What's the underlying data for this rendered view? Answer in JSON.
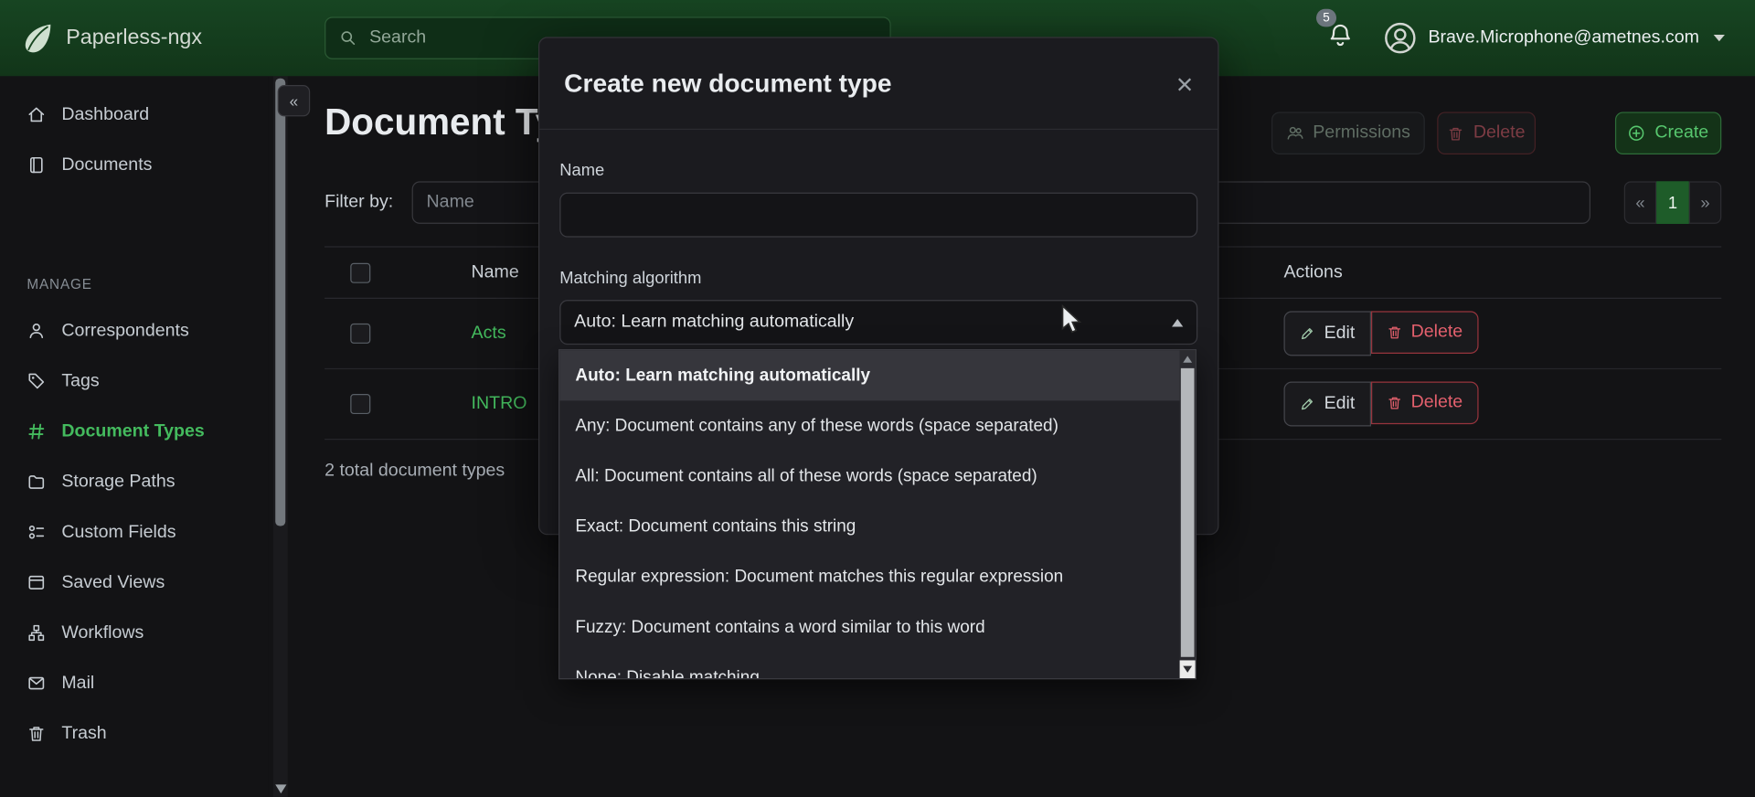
{
  "header": {
    "brand": "Paperless-ngx",
    "search_placeholder": "Search",
    "notification_count": "5",
    "user_email": "Brave.Microphone@ametnes.com"
  },
  "sidebar": {
    "collapse_label": "«",
    "section_label": "MANAGE",
    "items_top": [
      {
        "label": "Dashboard"
      },
      {
        "label": "Documents"
      }
    ],
    "items_manage": [
      {
        "label": "Correspondents"
      },
      {
        "label": "Tags"
      },
      {
        "label": "Document Types",
        "active": true
      },
      {
        "label": "Storage Paths"
      },
      {
        "label": "Custom Fields"
      },
      {
        "label": "Saved Views"
      },
      {
        "label": "Workflows"
      },
      {
        "label": "Mail"
      },
      {
        "label": "Trash"
      }
    ]
  },
  "page": {
    "title": "Document Types",
    "filter_label": "Filter by:",
    "filter_placeholder": "Name",
    "summary": "2 total document types",
    "buttons": {
      "permissions": "Permissions",
      "delete": "Delete",
      "create": "Create"
    },
    "pagination": {
      "prev": "«",
      "current": "1",
      "next": "»"
    },
    "table": {
      "headers": {
        "name": "Name",
        "actions": "Actions"
      },
      "rows": [
        {
          "name": "Acts",
          "edit": "Edit",
          "delete": "Delete"
        },
        {
          "name": "INTRO",
          "edit": "Edit",
          "delete": "Delete"
        }
      ]
    }
  },
  "modal": {
    "title": "Create new document type",
    "close": "×",
    "name_label": "Name",
    "matching_label": "Matching algorithm",
    "select_value": "Auto: Learn matching automatically",
    "options": [
      {
        "label": "Auto: Learn matching automatically",
        "selected": true
      },
      {
        "label": "Any: Document contains any of these words (space separated)"
      },
      {
        "label": "All: Document contains all of these words (space separated)"
      },
      {
        "label": "Exact: Document contains this string"
      },
      {
        "label": "Regular expression: Document matches this regular expression"
      },
      {
        "label": "Fuzzy: Document contains a word similar to this word"
      },
      {
        "label": "None: Disable matching"
      }
    ]
  },
  "colors": {
    "header_green": "#15401f",
    "accent_green": "#44bb5e",
    "danger_red": "#e4606d"
  }
}
